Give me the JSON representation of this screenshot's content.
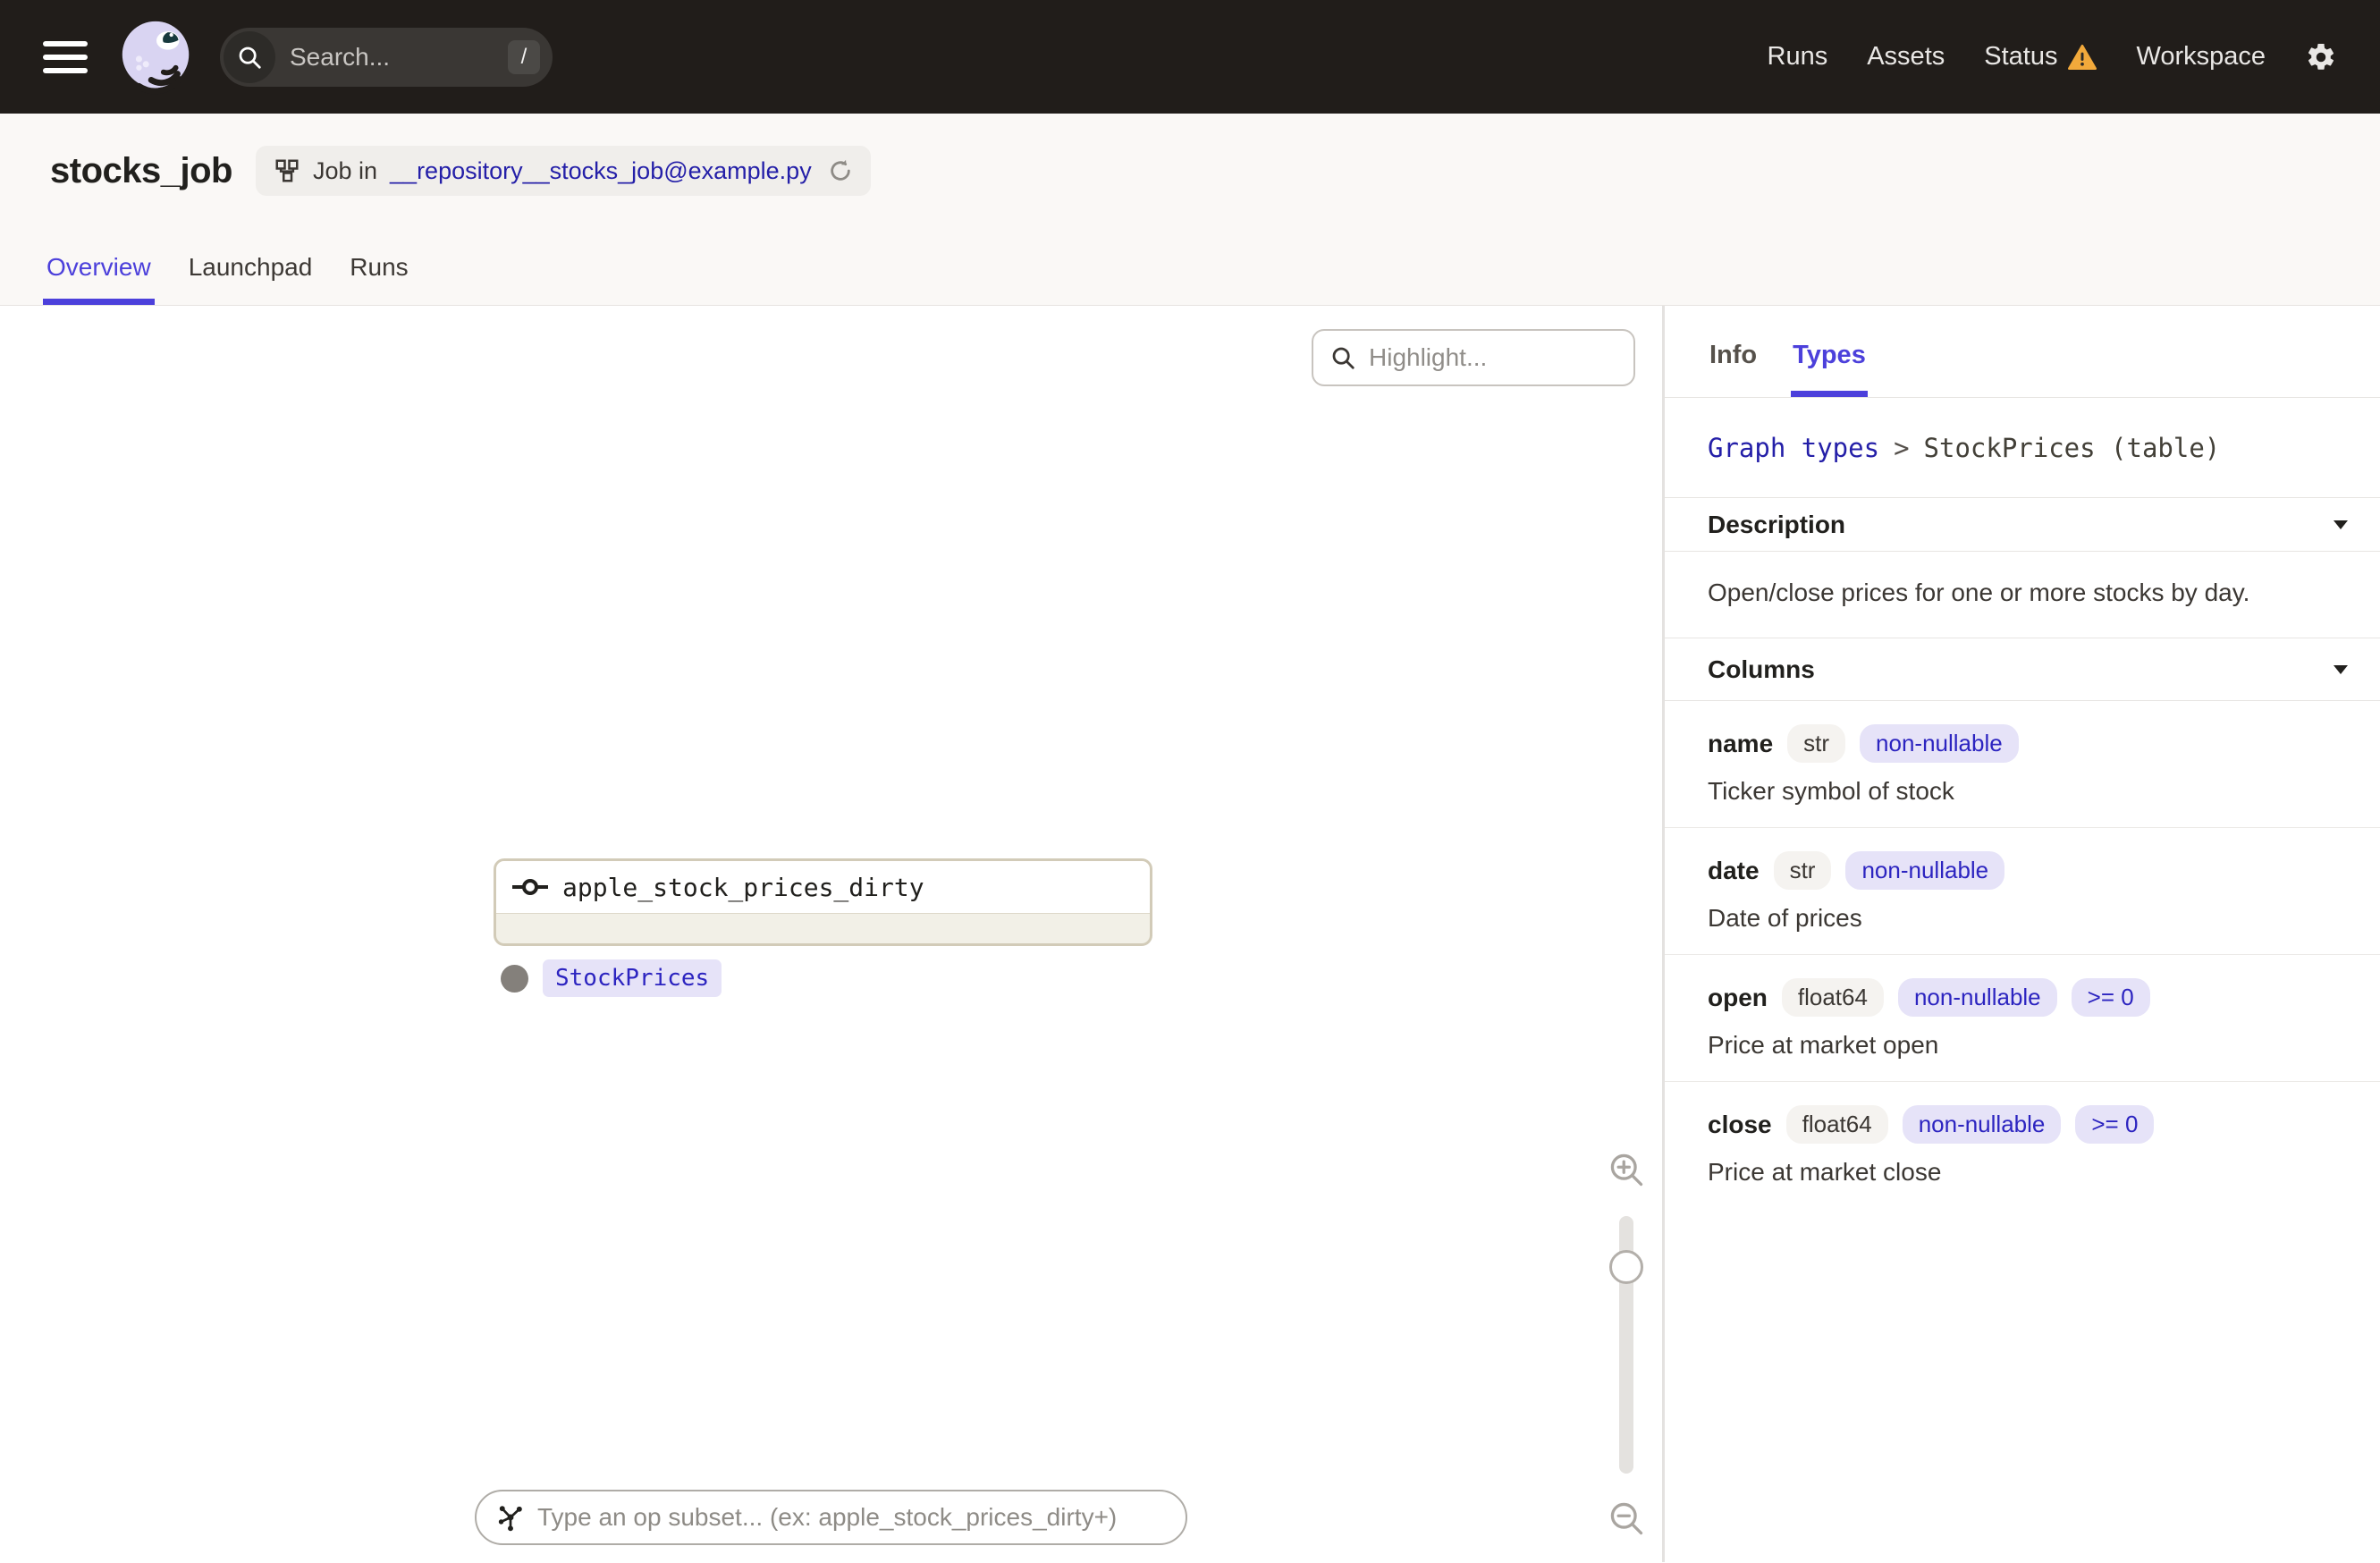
{
  "colors": {
    "topbar": "#211D1A",
    "accent_blurple": "#4C40DB",
    "link_navy": "#241FA8",
    "warning_amber": "#F2A93B",
    "node_border_tan": "#D2CBB8",
    "chip_lavender_bg": "#E6E3F8",
    "chip_gray_bg": "#F5F3F0"
  },
  "nav": {
    "search": {
      "placeholder": "Search...",
      "shortcut": "/"
    },
    "items": [
      {
        "label": "Runs"
      },
      {
        "label": "Assets"
      },
      {
        "label": "Status"
      },
      {
        "label": "Workspace"
      }
    ]
  },
  "header": {
    "title": "stocks_job",
    "job_tag": {
      "prefix": "Job in",
      "link": "__repository__stocks_job@example.py"
    }
  },
  "tabs": [
    {
      "label": "Overview"
    },
    {
      "label": "Launchpad"
    },
    {
      "label": "Runs"
    }
  ],
  "canvas": {
    "highlight_placeholder": "Highlight...",
    "node": {
      "title": "apple_stock_prices_dirty",
      "type_tag": "StockPrices"
    },
    "op_subset_placeholder": "Type an op subset... (ex: apple_stock_prices_dirty+)"
  },
  "sidebar": {
    "tabs": [
      {
        "label": "Info"
      },
      {
        "label": "Types"
      }
    ],
    "breadcrumb": {
      "link": "Graph types",
      "separator": ">",
      "current": "StockPrices (table)"
    },
    "description_section": {
      "title": "Description",
      "text": "Open/close prices for one or more stocks by day."
    },
    "columns_section": {
      "title": "Columns"
    },
    "columns": [
      {
        "name": "name",
        "type": "str",
        "badges": [
          "non-nullable"
        ],
        "description": "Ticker symbol of stock"
      },
      {
        "name": "date",
        "type": "str",
        "badges": [
          "non-nullable"
        ],
        "description": "Date of prices"
      },
      {
        "name": "open",
        "type": "float64",
        "badges": [
          "non-nullable",
          ">= 0"
        ],
        "description": "Price at market open"
      },
      {
        "name": "close",
        "type": "float64",
        "badges": [
          "non-nullable",
          ">= 0"
        ],
        "description": "Price at market close"
      }
    ]
  }
}
